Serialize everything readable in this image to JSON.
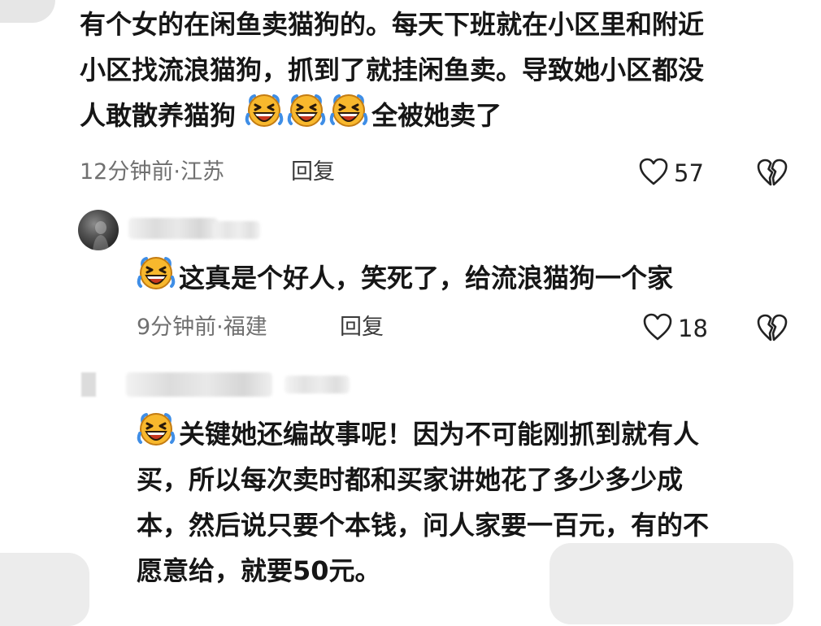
{
  "comments": [
    {
      "text": "有个女的在闲鱼卖猫狗的。每天下班就在小区里和附近\n小区找流浪猫狗，抓到了就挂闲鱼卖。导致她小区都没\n人敢散养猫狗",
      "text_tail": "全被她卖了",
      "meta": "12分钟前·江苏",
      "reply_label": "回复",
      "likes": "57",
      "emoji_icons": [
        "laughing-crying-emoji",
        "laughing-crying-emoji",
        "laughing-crying-emoji"
      ]
    },
    {
      "text": "这真是个好人，笑死了，给流浪猫狗一个家",
      "meta": "9分钟前·福建",
      "reply_label": "回复",
      "likes": "18",
      "emoji_icons": [
        "laughing-crying-emoji"
      ]
    },
    {
      "text": "关键她还编故事呢！因为不可能刚抓到就有人\n买，所以每次卖时都和买家讲她花了多少多少成\n本，然后说只要个本钱，问人家要一百元，有的不\n愿意给，就要50元。",
      "emoji_icons": [
        "laughing-crying-emoji"
      ]
    }
  ],
  "icons": {
    "like": "heart-outline-icon",
    "dislike": "broken-heart-icon"
  },
  "colors": {
    "text": "#161616",
    "meta": "#707070",
    "emoji_face": "#f8b82d",
    "emoji_tears": "#3f8ee6",
    "emoji_mouth": "#c8361f"
  }
}
